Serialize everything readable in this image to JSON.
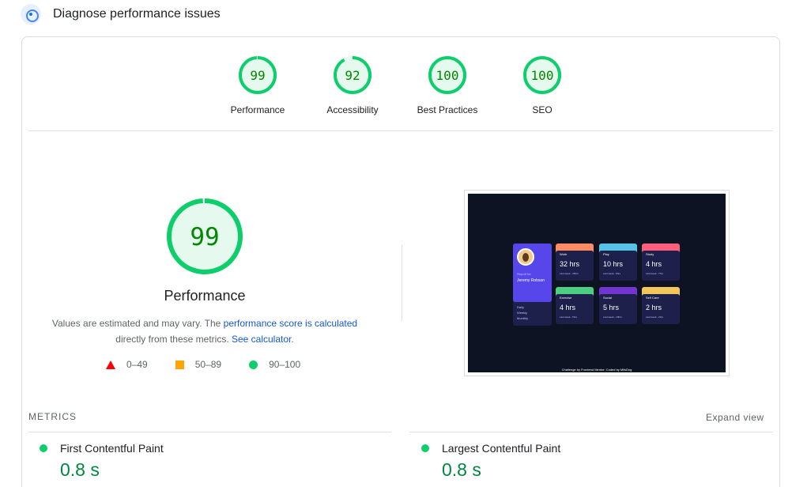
{
  "header": {
    "title": "Diagnose performance issues",
    "icon": "diagnose-icon"
  },
  "gauges": [
    {
      "score": "99",
      "value": 99,
      "label": "Performance"
    },
    {
      "score": "92",
      "value": 92,
      "label": "Accessibility"
    },
    {
      "score": "100",
      "value": 100,
      "label": "Best Practices"
    },
    {
      "score": "100",
      "value": 100,
      "label": "SEO"
    }
  ],
  "performance": {
    "score": "99",
    "value": 99,
    "title": "Performance",
    "desc_part1": "Values are estimated and may vary. The ",
    "link1": "performance score is calculated",
    "desc_part2": "directly from these metrics. ",
    "link2": "See calculator",
    "desc_end": "."
  },
  "legend": {
    "fail": "0–49",
    "average": "50–89",
    "pass": "90–100"
  },
  "screenshot": {
    "profile_report_for": "Report for",
    "profile_name": "Jeremy Robson",
    "periods": [
      "Daily",
      "Weekly",
      "Monthly"
    ],
    "cards": [
      {
        "title": "Work",
        "hrs": "32 hrs",
        "last": "Last week - 36hrs",
        "color": "#ff8b64"
      },
      {
        "title": "Play",
        "hrs": "10 hrs",
        "last": "Last week - 8hrs",
        "color": "#55c2e6"
      },
      {
        "title": "Study",
        "hrs": "4 hrs",
        "last": "Last week - 7hrs",
        "color": "#ff5e7d"
      },
      {
        "title": "Exercise",
        "hrs": "4 hrs",
        "last": "Last week - 5hrs",
        "color": "#4bcf82"
      },
      {
        "title": "Social",
        "hrs": "5 hrs",
        "last": "Last week - 10hrs",
        "color": "#7335d2"
      },
      {
        "title": "Self Care",
        "hrs": "2 hrs",
        "last": "Last week - 2hrs",
        "color": "#f1c75b"
      }
    ],
    "footer": "Challenge by Frontend Mentor. Coded by MilsDog"
  },
  "metrics": {
    "section_title": "METRICS",
    "expand_label": "Expand view",
    "items": [
      {
        "name": "First Contentful Paint",
        "value": "0.8 s"
      },
      {
        "name": "Largest Contentful Paint",
        "value": "0.8 s"
      }
    ]
  },
  "colors": {
    "pass": "#0cce6b",
    "pass_text": "#008800",
    "pass_bg": "#e6f9ef",
    "average": "#ffa400",
    "fail": "#ff0000",
    "link": "#1558d6"
  }
}
